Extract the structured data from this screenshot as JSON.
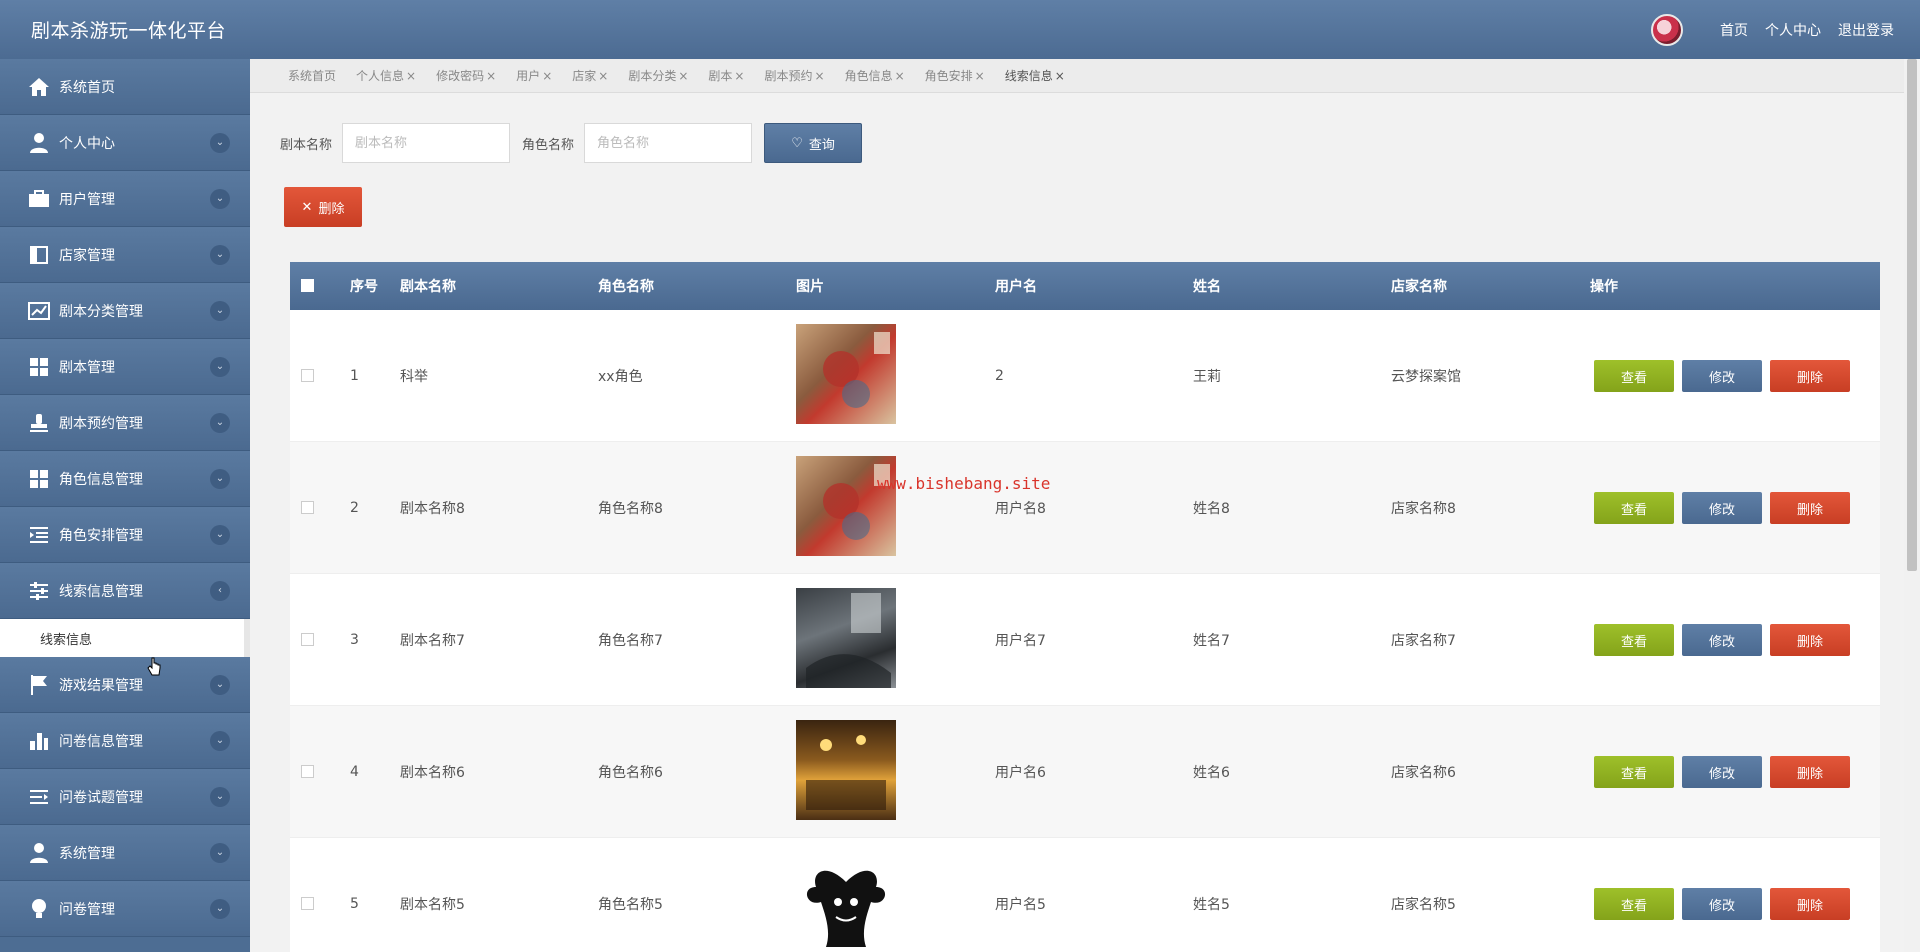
{
  "header": {
    "brand": "剧本杀游玩一体化平台",
    "links": [
      "首页",
      "个人中心",
      "退出登录"
    ]
  },
  "sidebar": {
    "items": [
      {
        "label": "系统首页",
        "icon": "home-icon"
      },
      {
        "label": "个人中心",
        "icon": "person-icon"
      },
      {
        "label": "用户管理",
        "icon": "briefcase-icon"
      },
      {
        "label": "店家管理",
        "icon": "book-icon"
      },
      {
        "label": "剧本分类管理",
        "icon": "chart-icon"
      },
      {
        "label": "剧本管理",
        "icon": "grid-icon"
      },
      {
        "label": "剧本预约管理",
        "icon": "stamp-icon"
      },
      {
        "label": "角色信息管理",
        "icon": "grid-icon"
      },
      {
        "label": "角色安排管理",
        "icon": "indent-icon"
      },
      {
        "label": "线索信息管理",
        "icon": "sliders-icon"
      },
      {
        "label": "游戏结果管理",
        "icon": "flag-icon"
      },
      {
        "label": "问卷信息管理",
        "icon": "bar-chart-icon"
      },
      {
        "label": "问卷试题管理",
        "icon": "list-icon"
      },
      {
        "label": "系统管理",
        "icon": "person-icon"
      },
      {
        "label": "问卷管理",
        "icon": "bulb-icon"
      }
    ],
    "submenu": {
      "label": "线索信息"
    }
  },
  "tabs": [
    "系统首页",
    "个人信息",
    "修改密码",
    "用户",
    "店家",
    "剧本分类",
    "剧本",
    "剧本预约",
    "角色信息",
    "角色安排",
    "线索信息"
  ],
  "search": {
    "label1": "剧本名称",
    "placeholder1": "剧本名称",
    "label2": "角色名称",
    "placeholder2": "角色名称",
    "query_label": "查询"
  },
  "delete_label": "删除",
  "table": {
    "columns": [
      "序号",
      "剧本名称",
      "角色名称",
      "图片",
      "用户名",
      "姓名",
      "店家名称",
      "操作"
    ],
    "rows": [
      {
        "no": "1",
        "script": "科举",
        "role": "xx角色",
        "user": "2",
        "name": "王莉",
        "shop": "云梦探案馆"
      },
      {
        "no": "2",
        "script": "剧本名称8",
        "role": "角色名称8",
        "user": "用户名8",
        "name": "姓名8",
        "shop": "店家名称8"
      },
      {
        "no": "3",
        "script": "剧本名称7",
        "role": "角色名称7",
        "user": "用户名7",
        "name": "姓名7",
        "shop": "店家名称7"
      },
      {
        "no": "4",
        "script": "剧本名称6",
        "role": "角色名称6",
        "user": "用户名6",
        "name": "姓名6",
        "shop": "店家名称6"
      },
      {
        "no": "5",
        "script": "剧本名称5",
        "role": "角色名称5",
        "user": "用户名5",
        "name": "姓名5",
        "shop": "店家名称5"
      }
    ],
    "actions": {
      "view": "查看",
      "edit": "修改",
      "delete": "删除"
    }
  },
  "watermark": "www.bishebang.site"
}
